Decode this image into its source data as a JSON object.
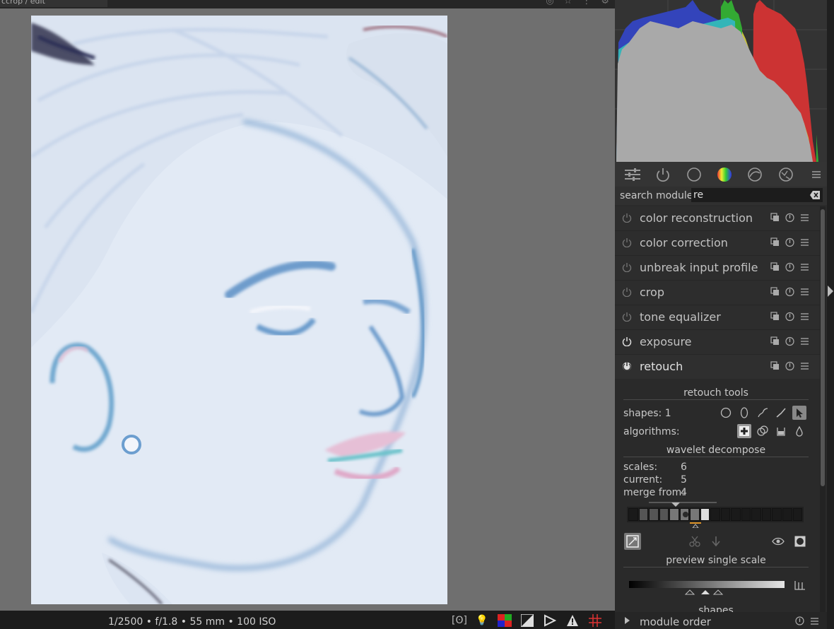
{
  "topbar": {
    "crumb": "ccrop / edit"
  },
  "status": {
    "exif": "1/2500 • f/1.8 • 55 mm • 100 ISO"
  },
  "search": {
    "label": "search module",
    "value": "re"
  },
  "modules": [
    {
      "name": "color reconstruction",
      "enabled": false
    },
    {
      "name": "color correction",
      "enabled": false
    },
    {
      "name": "unbreak input profile",
      "enabled": false
    },
    {
      "name": "crop",
      "enabled": false
    },
    {
      "name": "tone equalizer",
      "enabled": false
    },
    {
      "name": "exposure",
      "enabled": true
    },
    {
      "name": "retouch",
      "enabled": true,
      "expanded": true
    }
  ],
  "retouch": {
    "tools_title": "retouch tools",
    "shapes_label": "shapes: 1",
    "algorithms_label": "algorithms:",
    "wavelet_title": "wavelet decompose",
    "scales_label": "scales:",
    "scales_value": "6",
    "current_label": "current:",
    "current_value": "5",
    "merge_label": "merge from:",
    "merge_value": "4",
    "preview_title": "preview single scale",
    "shapes_section": "shapes"
  },
  "footer": {
    "module_order": "module order"
  },
  "colors": {
    "panel": "#2b2b2b",
    "view": "#6f6f6f",
    "accent_orange": "#e0962a"
  }
}
